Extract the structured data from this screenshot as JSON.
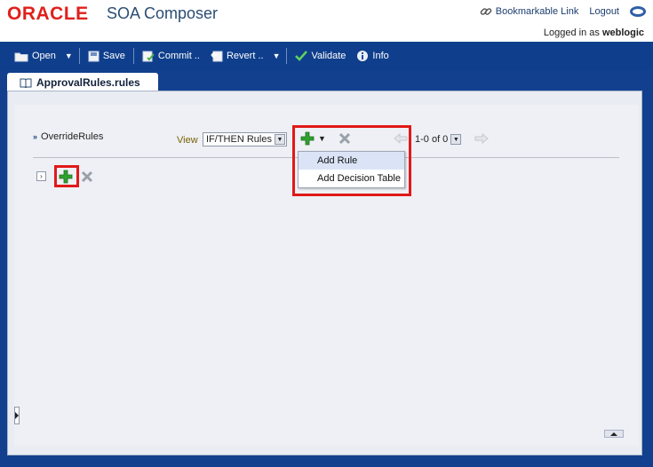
{
  "header": {
    "oracle_logo": "ORACLE",
    "product_name": "SOA Composer",
    "bookmarkable_link": "Bookmarkable Link",
    "logout": "Logout",
    "logged_in_prefix": "Logged in as",
    "username": "weblogic"
  },
  "toolbar": {
    "open": "Open",
    "save": "Save",
    "commit": "Commit ..",
    "revert": "Revert ..",
    "validate": "Validate",
    "info": "Info"
  },
  "tab": {
    "label": "ApprovalRules.rules"
  },
  "rules": {
    "ruleset_name": "OverrideRules",
    "view_label": "View",
    "view_selected": "IF/THEN Rules",
    "pager_text": "1-0 of 0"
  },
  "add_menu": {
    "items": [
      "Add Rule",
      "Add Decision Table"
    ]
  },
  "colors": {
    "brand_red": "#e0201b",
    "toolbar_blue": "#0f3f8c",
    "highlight_red": "#e11919",
    "add_green": "#2fa12f"
  }
}
